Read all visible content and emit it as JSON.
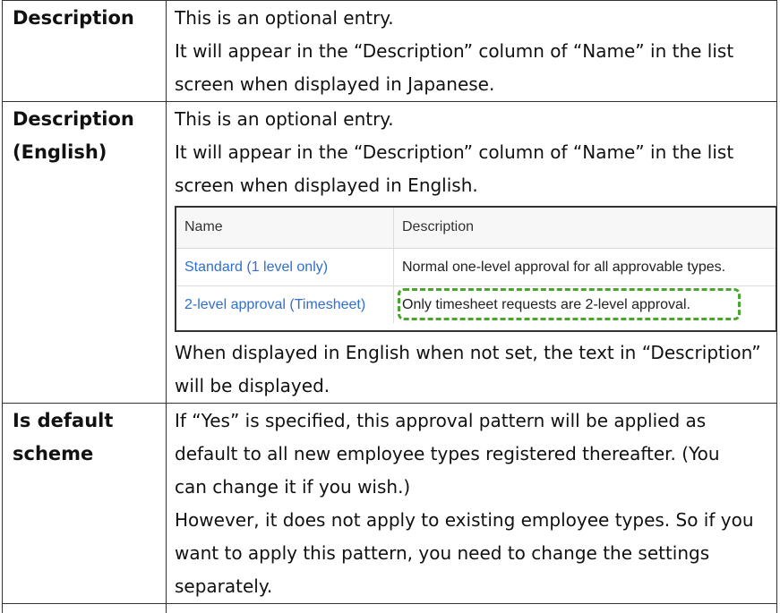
{
  "rows": [
    {
      "label_lines": [
        "Description"
      ],
      "content_lines": [
        "This is an optional entry.",
        "It will appear in the “Description” column of “Name” in the list",
        "screen when displayed in Japanese."
      ]
    },
    {
      "label_lines": [
        "Description",
        "(English)"
      ],
      "content_lines": [
        "This is an optional entry.",
        "It will appear in the “Description” column of “Name” in the list",
        "screen when displayed in English."
      ],
      "embedded_screenshot": {
        "headers": {
          "name": "Name",
          "description": "Description"
        },
        "rows": [
          {
            "name": "Standard (1 level only)",
            "description": "Normal one-level approval for all approvable types."
          },
          {
            "name": "2-level approval (Timesheet)",
            "description": "Only timesheet requests are 2-level approval."
          }
        ],
        "highlight_color": "#4aa52e",
        "link_color": "#2e6fd1"
      },
      "after_lines": [
        "When displayed in English when not set, the text in “Description”",
        "will be displayed."
      ]
    },
    {
      "label_lines": [
        "Is default",
        "scheme"
      ],
      "content_lines": [
        "If “Yes” is specified, this approval pattern will be applied as",
        "default to all new employee types registered thereafter. (You",
        "can change it if you wish.)",
        "However, it does not apply to existing employee types. So if you",
        "want to apply this pattern, you need to change the settings",
        "separately."
      ]
    }
  ]
}
